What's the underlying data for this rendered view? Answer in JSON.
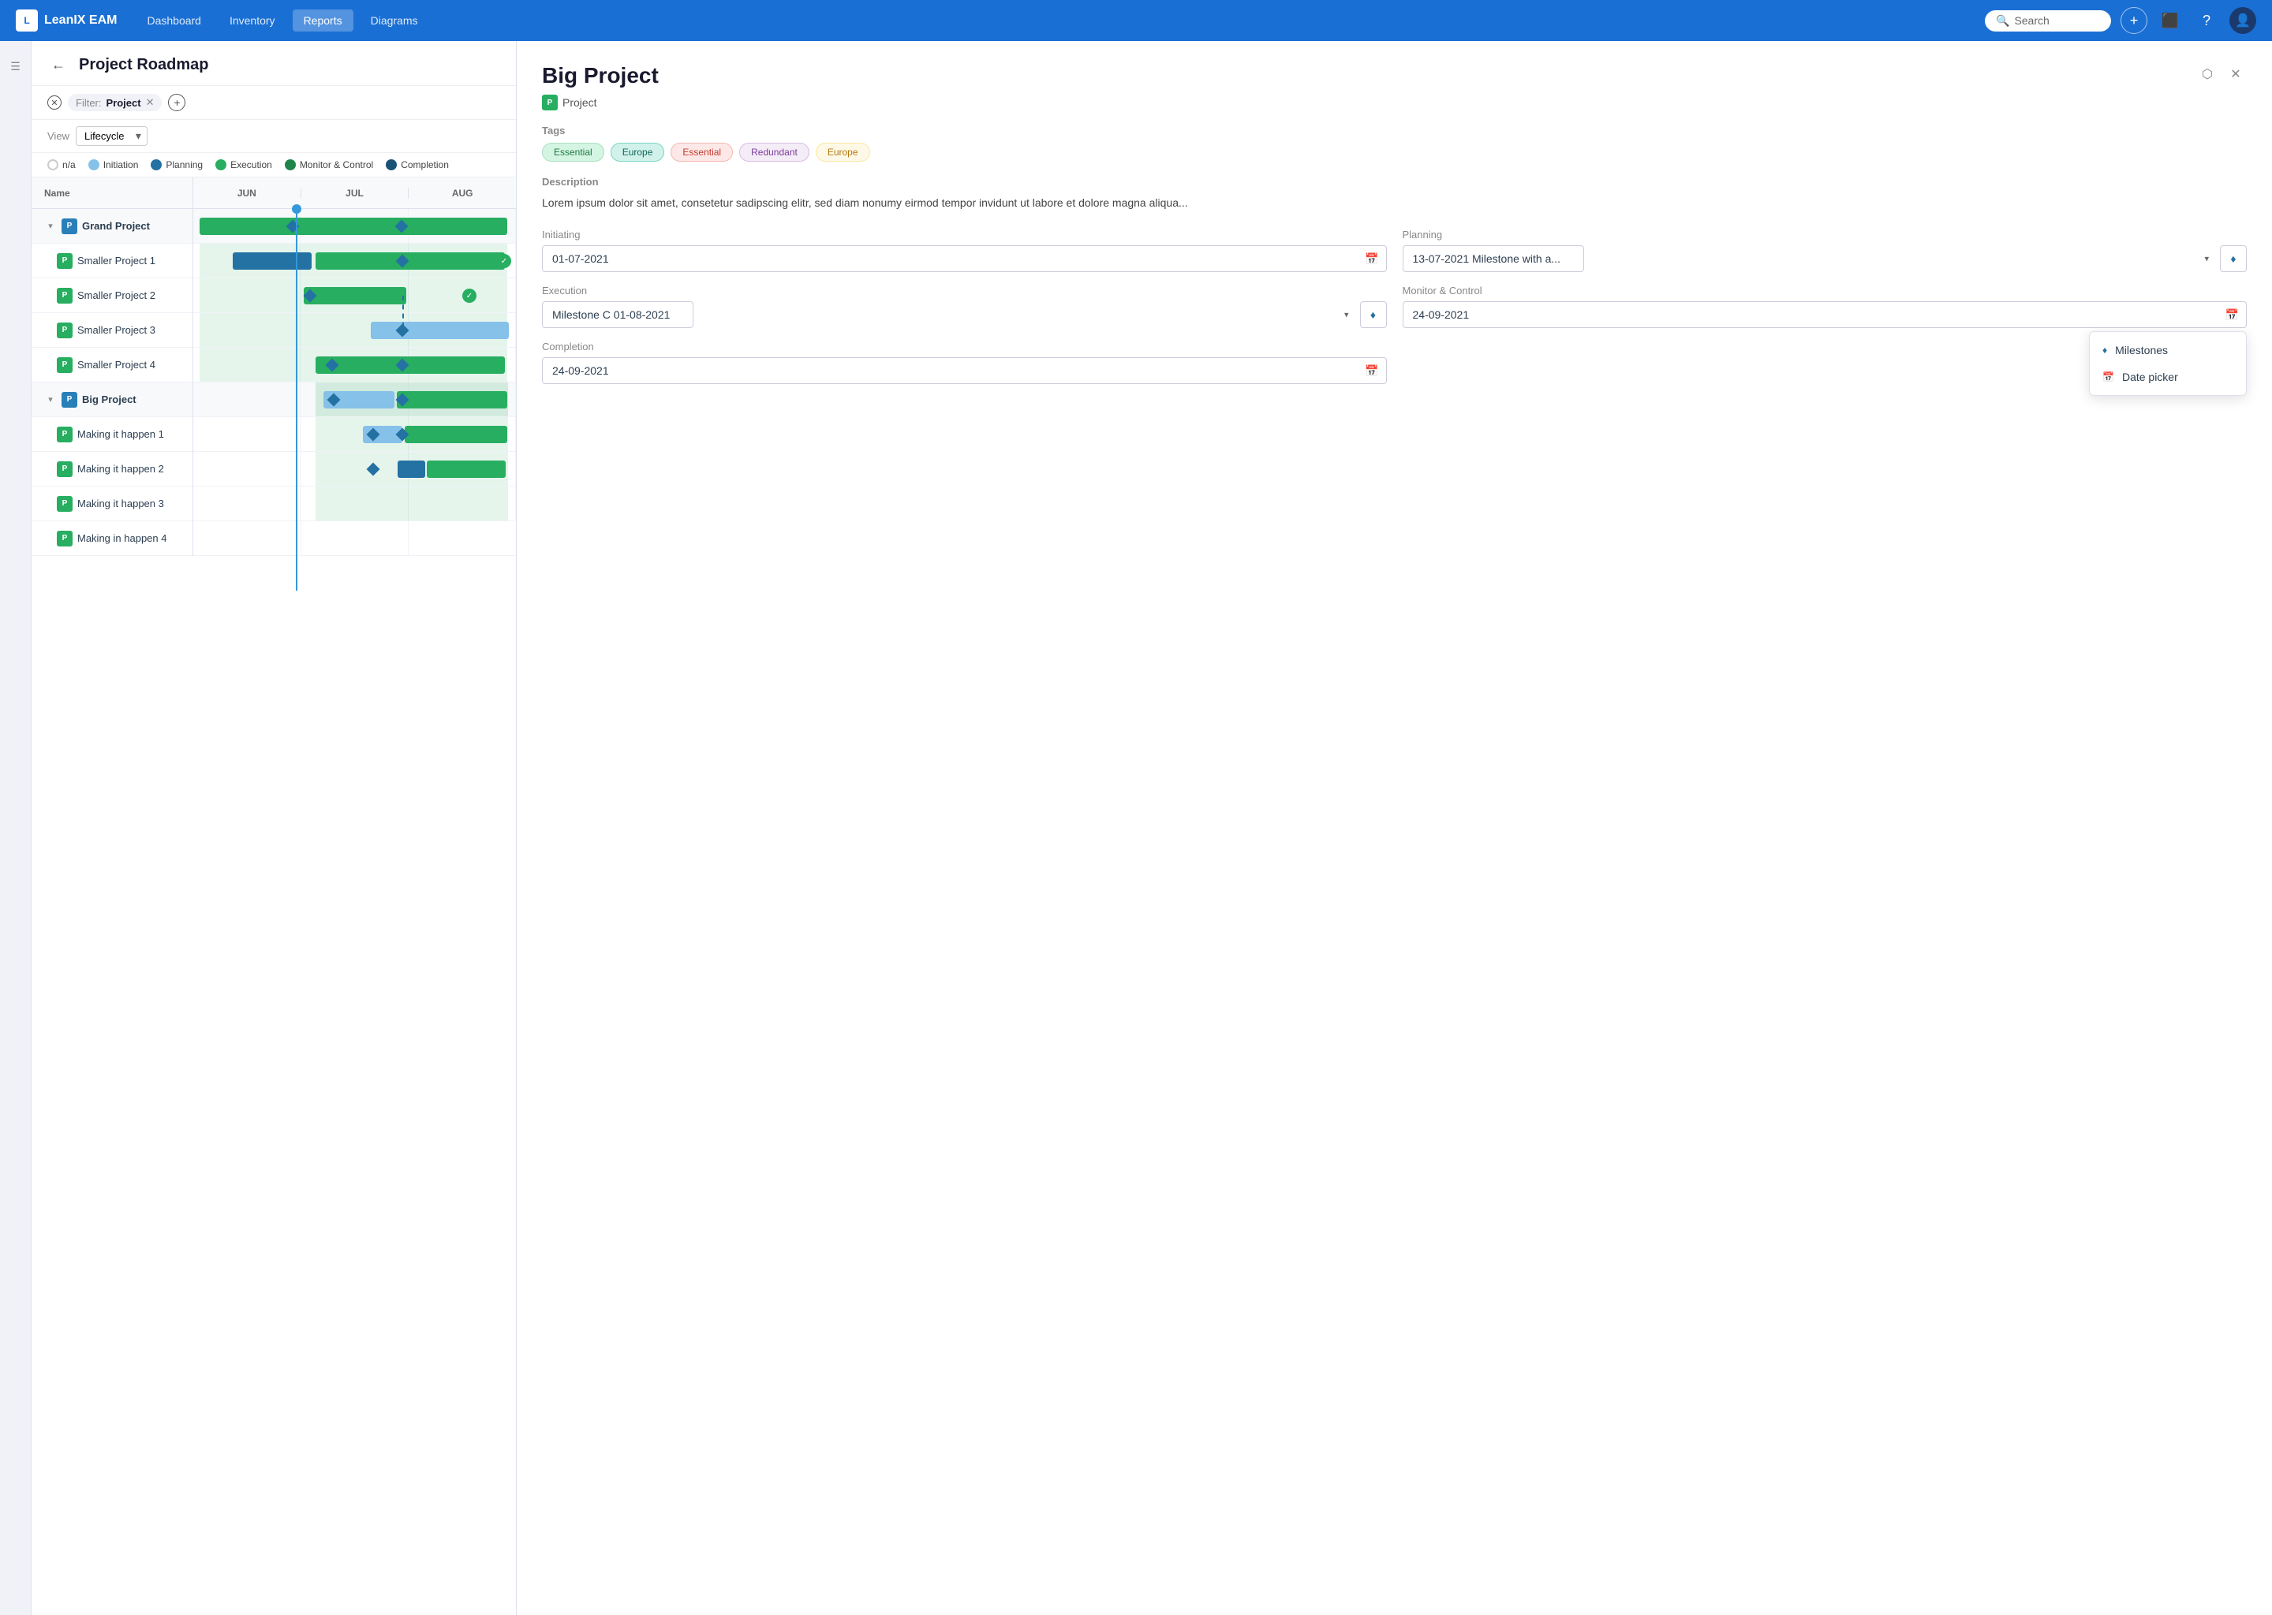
{
  "app": {
    "logo": "LeanIX EAM",
    "logo_short": "L"
  },
  "nav": {
    "links": [
      "Dashboard",
      "Inventory",
      "Reports",
      "Diagrams"
    ],
    "active": "Reports",
    "search_placeholder": "Search",
    "search_label": "Search"
  },
  "page": {
    "title": "Project Roadmap",
    "back_label": "←"
  },
  "filter": {
    "filter_label": "Filter:",
    "filter_value": "Project",
    "view_label": "View",
    "view_option": "Lifecycle"
  },
  "legend": {
    "items": [
      {
        "id": "na",
        "label": "n/a",
        "type": "ring"
      },
      {
        "id": "initiation",
        "label": "Initiation",
        "color": "#85c1e9"
      },
      {
        "id": "planning",
        "label": "Planning",
        "color": "#2471a3"
      },
      {
        "id": "execution",
        "label": "Execution",
        "color": "#27ae60"
      },
      {
        "id": "monitor",
        "label": "Monitor & Control",
        "color": "#1e8449"
      },
      {
        "id": "completion",
        "label": "Completion",
        "color": "#1a5276"
      }
    ]
  },
  "gantt": {
    "name_header": "Name",
    "months": [
      "JUN",
      "JUL",
      "AUG"
    ],
    "rows": [
      {
        "id": "grand-project",
        "name": "Grand Project",
        "type": "group",
        "collapsed": false,
        "badge_color": "blue"
      },
      {
        "id": "smaller-1",
        "name": "Smaller Project 1",
        "type": "child",
        "badge_color": "green"
      },
      {
        "id": "smaller-2",
        "name": "Smaller Project 2",
        "type": "child",
        "badge_color": "green"
      },
      {
        "id": "smaller-3",
        "name": "Smaller Project 3",
        "type": "child",
        "badge_color": "green"
      },
      {
        "id": "smaller-4",
        "name": "Smaller Project 4",
        "type": "child",
        "badge_color": "green"
      },
      {
        "id": "big-project",
        "name": "Big Project",
        "type": "group",
        "collapsed": false,
        "badge_color": "blue"
      },
      {
        "id": "making-1",
        "name": "Making it happen 1",
        "type": "child",
        "badge_color": "green"
      },
      {
        "id": "making-2",
        "name": "Making it happen 2",
        "type": "child",
        "badge_color": "green"
      },
      {
        "id": "making-3",
        "name": "Making it happen 3",
        "type": "child",
        "badge_color": "green"
      },
      {
        "id": "making-4",
        "name": "Making in happen 4",
        "type": "child",
        "badge_color": "green"
      }
    ]
  },
  "detail": {
    "title": "Big Project",
    "type_badge": "P",
    "type_label": "Project",
    "tags_label": "Tags",
    "tags": [
      {
        "label": "Essential",
        "style": "green"
      },
      {
        "label": "Europe",
        "style": "teal"
      },
      {
        "label": "Essential",
        "style": "pink"
      },
      {
        "label": "Redundant",
        "style": "purple"
      },
      {
        "label": "Europe",
        "style": "orange"
      }
    ],
    "description_label": "Description",
    "description": "Lorem ipsum dolor sit amet, consetetur sadipscing elitr, sed diam nonumy eirmod tempor invidunt ut labore et dolore magna aliqua...",
    "fields": {
      "initiating_label": "Initiating",
      "initiating_value": "01-07-2021",
      "planning_label": "Planning",
      "planning_value": "13-07-2021",
      "planning_select": "Milestone with a...",
      "execution_label": "Execution",
      "execution_milestone": "Milestone C",
      "execution_date": "01-08-2021",
      "monitor_label": "Monitor & Control",
      "monitor_value": "24-09-2021",
      "completion_label": "Completion",
      "completion_value": "24-09-2021"
    },
    "dropdown": {
      "items": [
        {
          "label": "Milestones",
          "icon": "diamond"
        },
        {
          "label": "Date picker",
          "icon": "calendar"
        }
      ]
    }
  }
}
